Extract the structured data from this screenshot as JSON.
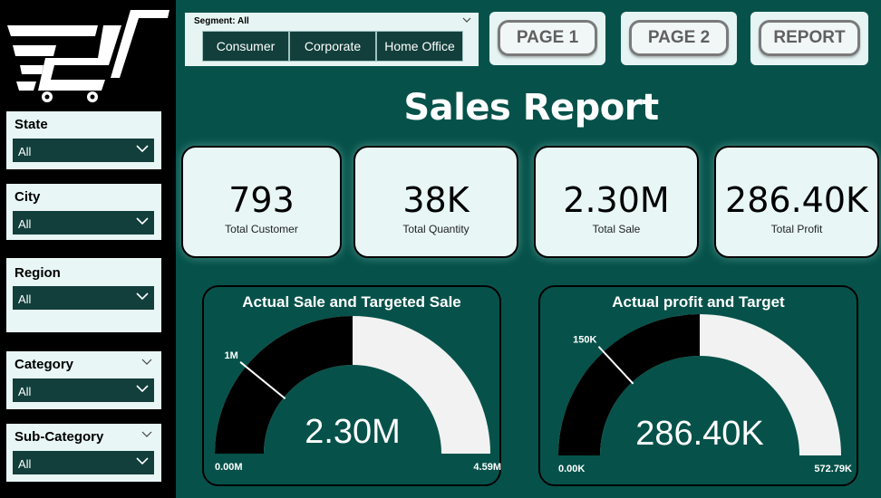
{
  "sidebar": {
    "filters": [
      {
        "label": "State",
        "value": "All",
        "has_top_chevron": false
      },
      {
        "label": "City",
        "value": "All",
        "has_top_chevron": false
      },
      {
        "label": "Region",
        "value": "All",
        "has_top_chevron": false
      },
      {
        "label": "Category",
        "value": "All",
        "has_top_chevron": true
      },
      {
        "label": "Sub-Category",
        "value": "All",
        "has_top_chevron": true
      }
    ]
  },
  "segment": {
    "label": "Segment: All",
    "options": [
      "Consumer",
      "Corporate",
      "Home Office"
    ]
  },
  "nav": {
    "page1": "PAGE 1",
    "page2": "PAGE 2",
    "report": "REPORT"
  },
  "title": "Sales Report",
  "kpis": [
    {
      "value": "793",
      "label": "Total Customer"
    },
    {
      "value": "38K",
      "label": "Total Quantity"
    },
    {
      "value": "2.30M",
      "label": "Total Sale"
    },
    {
      "value": "286.40K",
      "label": "Total Profit"
    }
  ],
  "gauges": [
    {
      "title": "Actual Sale and Targeted Sale",
      "value_label": "2.30M",
      "min_label": "0.00M",
      "max_label": "4.59M",
      "target_label": "1M",
      "fill_fraction": 0.5,
      "target_fraction": 0.218
    },
    {
      "title": "Actual profit and Target",
      "value_label": "286.40K",
      "min_label": "0.00K",
      "max_label": "572.79K",
      "target_label": "150K",
      "fill_fraction": 0.5,
      "target_fraction": 0.262
    }
  ],
  "colors": {
    "background": "#06524a",
    "dark_teal": "#123f3b",
    "card": "#e8f6f6",
    "gauge_fill": "#000000",
    "gauge_track": "#f2f2f2"
  }
}
